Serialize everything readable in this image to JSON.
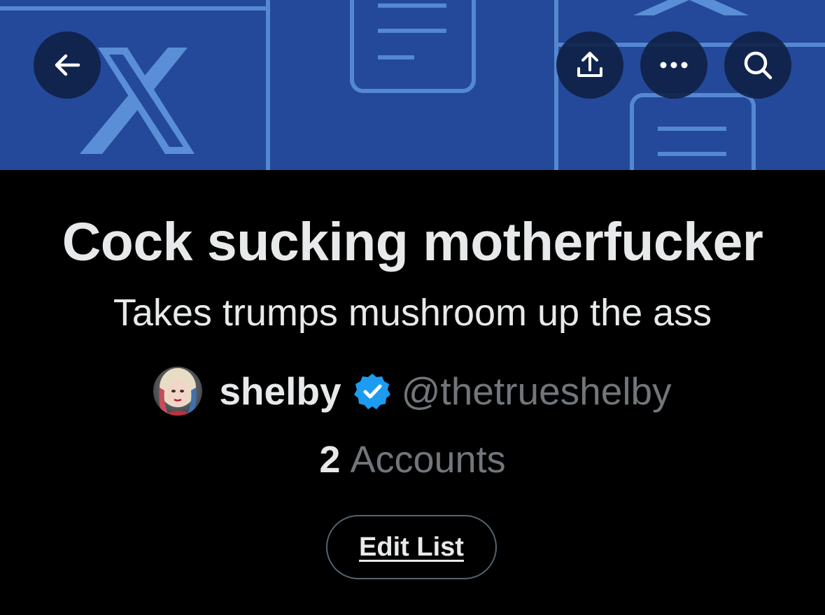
{
  "header": {
    "back_icon": "arrow-left-icon",
    "share_icon": "share-upload-icon",
    "more_icon": "more-dots-icon",
    "search_icon": "search-icon",
    "banner_color": "#24499a",
    "banner_pattern_color": "#5a8fd8"
  },
  "list": {
    "title": "Cock sucking motherfucker",
    "description": "Takes trumps mushroom up the ass",
    "owner": {
      "name": "shelby",
      "handle": "@thetrueshelby",
      "verified": true,
      "verified_color": "#1d9bf0"
    },
    "accounts_count": "2",
    "accounts_label": "Accounts",
    "edit_button_label": "Edit List"
  }
}
